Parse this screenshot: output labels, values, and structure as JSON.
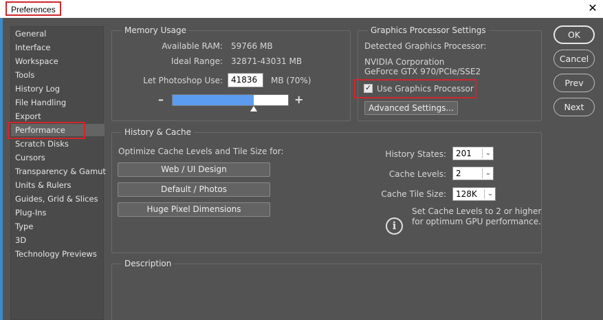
{
  "window": {
    "title": "Preferences",
    "close_glyph": "✕"
  },
  "sidebar": {
    "items": [
      {
        "label": "General"
      },
      {
        "label": "Interface"
      },
      {
        "label": "Workspace"
      },
      {
        "label": "Tools"
      },
      {
        "label": "History Log"
      },
      {
        "label": "File Handling"
      },
      {
        "label": "Export"
      },
      {
        "label": "Performance"
      },
      {
        "label": "Scratch Disks"
      },
      {
        "label": "Cursors"
      },
      {
        "label": "Transparency & Gamut"
      },
      {
        "label": "Units & Rulers"
      },
      {
        "label": "Guides, Grid & Slices"
      },
      {
        "label": "Plug-Ins"
      },
      {
        "label": "Type"
      },
      {
        "label": "3D"
      },
      {
        "label": "Technology Previews"
      }
    ],
    "selected": "Performance"
  },
  "memory": {
    "legend": "Memory Usage",
    "available_label": "Available RAM:",
    "available_value": "59766 MB",
    "ideal_label": "Ideal Range:",
    "ideal_value": "32871-43031 MB",
    "let_label": "Let Photoshop Use:",
    "let_value": "41836",
    "let_unit": "MB (70%)",
    "slider_fraction": 0.7,
    "minus": "–",
    "plus": "+"
  },
  "gpu": {
    "legend": "Graphics Processor Settings",
    "detected_label": "Detected Graphics Processor:",
    "vendor": "NVIDIA Corporation",
    "model": "GeForce GTX 970/PCIe/SSE2",
    "use_label": "Use Graphics Processor",
    "use_checked": true,
    "advanced_button": "Advanced Settings..."
  },
  "history": {
    "legend": "History & Cache",
    "optimize_label": "Optimize Cache Levels and Tile Size for:",
    "buttons": [
      "Web / UI Design",
      "Default / Photos",
      "Huge Pixel Dimensions"
    ],
    "states_label": "History States:",
    "states_value": "201",
    "levels_label": "Cache Levels:",
    "levels_value": "2",
    "tile_label": "Cache Tile Size:",
    "tile_value": "128K",
    "info_line1": "Set Cache Levels to 2 or higher",
    "info_line2": "for optimum GPU performance.",
    "info_glyph": "i"
  },
  "description": {
    "legend": "Description"
  },
  "actions": {
    "ok": "OK",
    "cancel": "Cancel",
    "prev": "Prev",
    "next": "Next"
  },
  "icons": {
    "checkbox_tick": "✓",
    "chevron": "⌄"
  },
  "colors": {
    "accent": "#5b9cf0",
    "highlight": "#d0262d",
    "panel_bg": "#535353"
  }
}
